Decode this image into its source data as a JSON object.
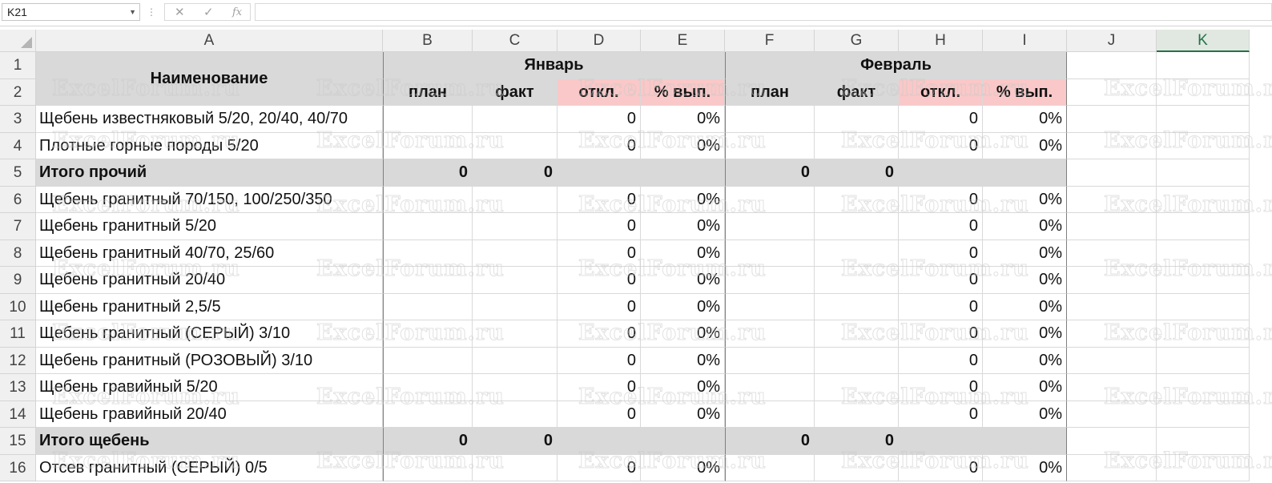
{
  "formula_bar": {
    "name_box": "K21",
    "cancel_icon": "✕",
    "enter_icon": "✓",
    "fx_icon": "fx",
    "separator": "⋮",
    "formula": ""
  },
  "columns": [
    "A",
    "B",
    "C",
    "D",
    "E",
    "F",
    "G",
    "H",
    "I",
    "J",
    "K"
  ],
  "active_column": "K",
  "rows": [
    "1",
    "2",
    "3",
    "4",
    "5",
    "6",
    "7",
    "8",
    "9",
    "10",
    "11",
    "12",
    "13",
    "14",
    "15",
    "16"
  ],
  "header": {
    "name_label": "Наименование",
    "month1": "Январь",
    "month2": "Февраль",
    "sub": [
      "план",
      "факт",
      "откл.",
      "% вып.",
      "план",
      "факт",
      "откл.",
      "% вып."
    ]
  },
  "data_rows": [
    {
      "name": "Щебень известняковый 5/20, 20/40, 40/70",
      "total": false,
      "vals": [
        "",
        "",
        "0",
        "0%",
        "",
        "",
        "0",
        "0%"
      ]
    },
    {
      "name": "Плотные горные породы 5/20",
      "total": false,
      "vals": [
        "",
        "",
        "0",
        "0%",
        "",
        "",
        "0",
        "0%"
      ]
    },
    {
      "name": "Итого прочий",
      "total": true,
      "vals": [
        "0",
        "0",
        "",
        "",
        "0",
        "0",
        "",
        ""
      ]
    },
    {
      "name": "Щебень гранитный 70/150, 100/250/350",
      "total": false,
      "vals": [
        "",
        "",
        "0",
        "0%",
        "",
        "",
        "0",
        "0%"
      ]
    },
    {
      "name": "Щебень гранитный 5/20",
      "total": false,
      "vals": [
        "",
        "",
        "0",
        "0%",
        "",
        "",
        "0",
        "0%"
      ]
    },
    {
      "name": "Щебень гранитный 40/70, 25/60",
      "total": false,
      "vals": [
        "",
        "",
        "0",
        "0%",
        "",
        "",
        "0",
        "0%"
      ]
    },
    {
      "name": "Щебень гранитный 20/40",
      "total": false,
      "vals": [
        "",
        "",
        "0",
        "0%",
        "",
        "",
        "0",
        "0%"
      ]
    },
    {
      "name": "Щебень гранитный 2,5/5",
      "total": false,
      "vals": [
        "",
        "",
        "0",
        "0%",
        "",
        "",
        "0",
        "0%"
      ]
    },
    {
      "name": "Щебень гранитный (СЕРЫЙ) 3/10",
      "total": false,
      "vals": [
        "",
        "",
        "0",
        "0%",
        "",
        "",
        "0",
        "0%"
      ]
    },
    {
      "name": "Щебень гранитный (РОЗОВЫЙ) 3/10",
      "total": false,
      "vals": [
        "",
        "",
        "0",
        "0%",
        "",
        "",
        "0",
        "0%"
      ]
    },
    {
      "name": "Щебень гравийный 5/20",
      "total": false,
      "vals": [
        "",
        "",
        "0",
        "0%",
        "",
        "",
        "0",
        "0%"
      ]
    },
    {
      "name": "Щебень гравийный 20/40",
      "total": false,
      "vals": [
        "",
        "",
        "0",
        "0%",
        "",
        "",
        "0",
        "0%"
      ]
    },
    {
      "name": "Итого щебень",
      "total": true,
      "vals": [
        "0",
        "0",
        "",
        "",
        "0",
        "0",
        "",
        ""
      ]
    },
    {
      "name": "Отсев гранитный (СЕРЫЙ) 0/5",
      "total": false,
      "vals": [
        "",
        "",
        "0",
        "0%",
        "",
        "",
        "0",
        "0%"
      ]
    }
  ],
  "watermark": "ExcelForum.ru"
}
